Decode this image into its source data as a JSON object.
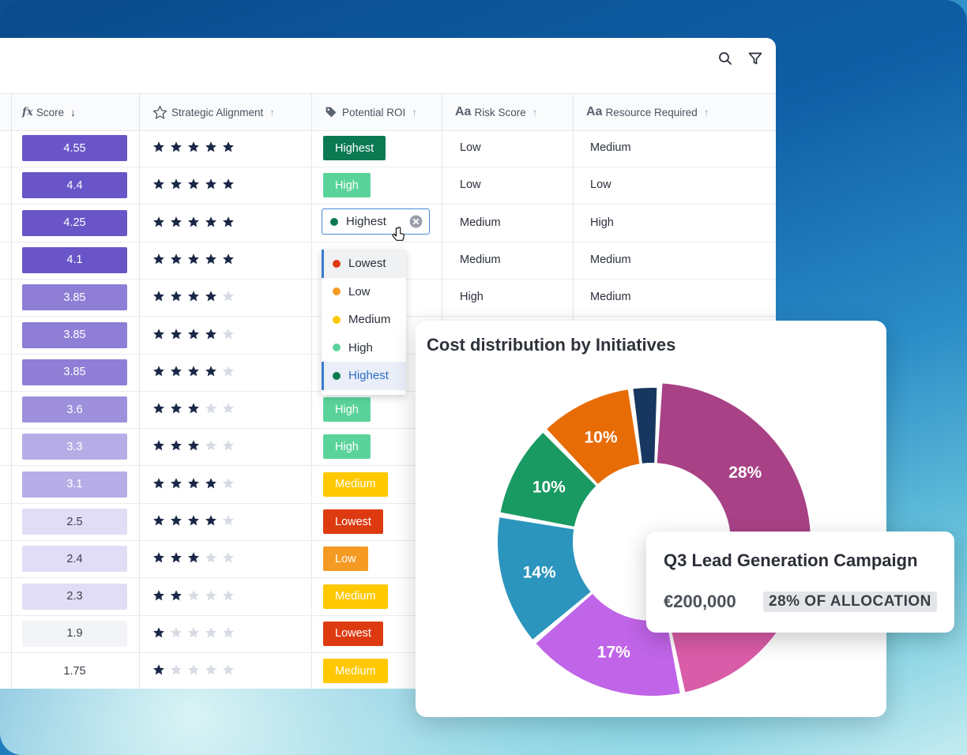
{
  "toolbar": {
    "search_icon": "search-icon",
    "filter_icon": "filter-icon"
  },
  "columns": [
    {
      "key": "score",
      "label": "Score",
      "icon": "fx",
      "sort": "↓"
    },
    {
      "key": "strategic",
      "label": "Strategic Alignment",
      "icon": "star-outline-icon",
      "sort": "↑"
    },
    {
      "key": "roi",
      "label": "Potential ROI",
      "icon": "tag-icon",
      "sort": "↑"
    },
    {
      "key": "risk",
      "label": "Risk Score",
      "icon": "Aa",
      "sort": "↑"
    },
    {
      "key": "resource",
      "label": "Resource Required",
      "icon": "Aa",
      "sort": "↑"
    }
  ],
  "rows": [
    {
      "score": "4.55",
      "stars": 5,
      "roi": "Highest",
      "risk": "Low",
      "resource": "Medium"
    },
    {
      "score": "4.4",
      "stars": 5,
      "roi": "High",
      "risk": "Low",
      "resource": "Low"
    },
    {
      "score": "4.25",
      "stars": 5,
      "roi": "Highest",
      "risk": "Medium",
      "resource": "High"
    },
    {
      "score": "4.1",
      "stars": 5,
      "roi": "",
      "risk": "Medium",
      "resource": "Medium"
    },
    {
      "score": "3.85",
      "stars": 4,
      "roi": "",
      "risk": "High",
      "resource": "Medium"
    },
    {
      "score": "3.85",
      "stars": 4,
      "roi": "",
      "risk": "",
      "resource": ""
    },
    {
      "score": "3.85",
      "stars": 4,
      "roi": "",
      "risk": "",
      "resource": ""
    },
    {
      "score": "3.6",
      "stars": 3,
      "roi": "High",
      "risk": "",
      "resource": ""
    },
    {
      "score": "3.3",
      "stars": 3,
      "roi": "High",
      "risk": "",
      "resource": ""
    },
    {
      "score": "3.1",
      "stars": 4,
      "roi": "Medium",
      "risk": "",
      "resource": ""
    },
    {
      "score": "2.5",
      "stars": 4,
      "roi": "Lowest",
      "risk": "",
      "resource": ""
    },
    {
      "score": "2.4",
      "stars": 3,
      "roi": "Low",
      "risk": "",
      "resource": ""
    },
    {
      "score": "2.3",
      "stars": 2,
      "roi": "Medium",
      "risk": "",
      "resource": ""
    },
    {
      "score": "1.9",
      "stars": 1,
      "roi": "Lowest",
      "risk": "",
      "resource": ""
    },
    {
      "score": "1.75",
      "stars": 1,
      "roi": "Medium",
      "risk": "",
      "resource": ""
    }
  ],
  "roi_colors": {
    "Highest": "#0b7a53",
    "High": "#5ad39a",
    "Medium": "#ffc800",
    "Low": "#f59a22",
    "Lowest": "#de3a12"
  },
  "editor": {
    "value": "Highest",
    "clear_icon": "clear-icon",
    "cursor_icon": "hand-cursor-icon"
  },
  "dropdown": {
    "options": [
      {
        "label": "Lowest",
        "color": "#de3a12"
      },
      {
        "label": "Low",
        "color": "#f59a22"
      },
      {
        "label": "Medium",
        "color": "#ffc800"
      },
      {
        "label": "High",
        "color": "#5ad39a"
      },
      {
        "label": "Highest",
        "color": "#0b7a53"
      }
    ],
    "selected": "Highest"
  },
  "chart_data": {
    "type": "pie",
    "title": "Cost distribution by Initiatives",
    "slices": [
      {
        "value": 28,
        "label": "28%",
        "color": "#a84186"
      },
      {
        "value": 18,
        "label": "",
        "color": "#d95ca8"
      },
      {
        "value": 17,
        "label": "17%",
        "color": "#c064e8"
      },
      {
        "value": 14,
        "label": "14%",
        "color": "#2b95bd"
      },
      {
        "value": 10,
        "label": "10%",
        "color": "#1a9a63"
      },
      {
        "value": 10,
        "label": "10%",
        "color": "#e86c05"
      },
      {
        "value": 3,
        "label": "",
        "color": "#173760"
      }
    ]
  },
  "tooltip": {
    "title": "Q3 Lead Generation Campaign",
    "amount": "€200,000",
    "badge": "28% OF ALLOCATION"
  }
}
